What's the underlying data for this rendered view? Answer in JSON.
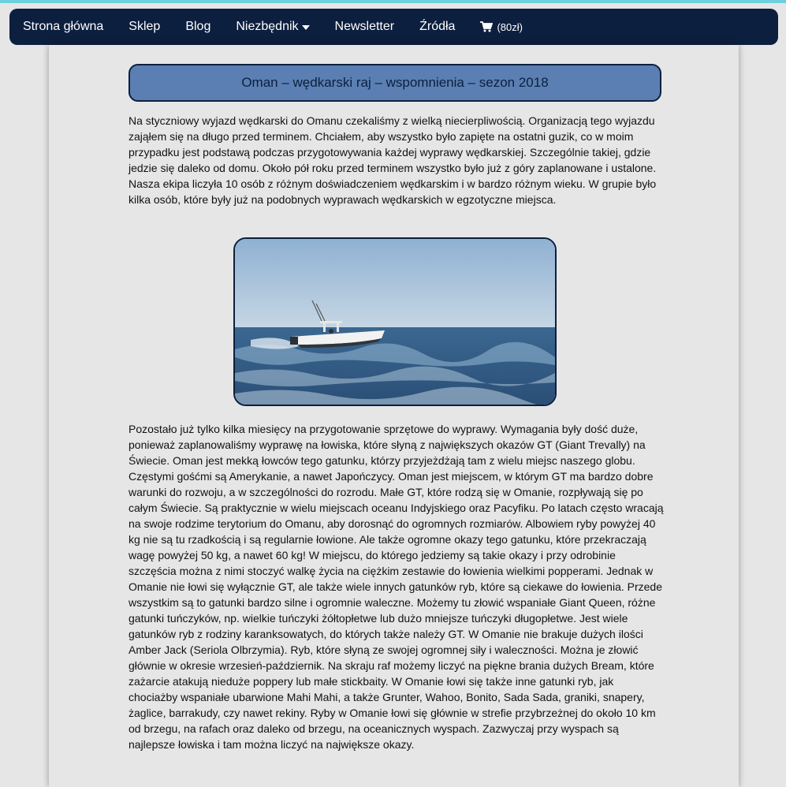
{
  "nav": {
    "items": [
      {
        "label": "Strona główna"
      },
      {
        "label": "Sklep"
      },
      {
        "label": "Blog"
      },
      {
        "label": "Niezbędnik"
      },
      {
        "label": "Newsletter"
      },
      {
        "label": "Źródła"
      }
    ],
    "cart_label": "(80zł)",
    "dropdown_icon": "caret-down-icon",
    "cart_icon": "shopping-cart-icon"
  },
  "article": {
    "title": "Oman – wędkarski raj – wspomnienia – sezon 2018",
    "paragraph1": "Na styczniowy wyjazd wędkarski do Omanu czekaliśmy z wielką niecierpliwością. Organizacją tego wyjazdu zająłem się na długo przed terminem. Chciałem, aby wszystko było zapięte na ostatni guzik, co w moim przypadku jest podstawą podczas przygotowywania każdej wyprawy wędkarskiej. Szczególnie takiej, gdzie jedzie się daleko od domu. Około pół roku przed terminem wszystko było już z góry zaplanowane i ustalone. Nasza ekipa liczyła 10 osób z różnym doświadczeniem wędkarskim i w bardzo różnym wieku. W grupie było kilka osób, które były już na podobnych wyprawach wędkarskich w egzotyczne miejsca.",
    "paragraph2": "Pozostało już tylko kilka miesięcy na przygotowanie sprzętowe do wyprawy. Wymagania były dość duże, ponieważ zaplanowaliśmy wyprawę na łowiska, które słyną z największych okazów GT (Giant Trevally) na Świecie. Oman jest mekką łowców tego gatunku, którzy przyjeżdżają tam z wielu miejsc naszego globu. Częstymi gośćmi są Amerykanie, a nawet Japończycy. Oman jest miejscem, w którym GT ma bardzo dobre warunki do rozwoju, a w szczególności do rozrodu. Małe GT, które rodzą się w Omanie, rozpływają się po całym Świecie. Są praktycznie w wielu miejscach oceanu Indyjskiego oraz Pacyfiku. Po latach często wracają na swoje rodzime terytorium do Omanu, aby dorosnąć do ogromnych rozmiarów. Albowiem ryby powyżej 40 kg nie są tu rzadkością i są regularnie łowione. Ale także ogromne okazy tego gatunku, które przekraczają wagę powyżej 50 kg, a nawet 60 kg! W miejscu, do którego jedziemy są takie okazy i przy odrobinie szczęścia można z nimi stoczyć walkę życia na ciężkim zestawie do łowienia wielkimi popperami. Jednak w Omanie nie łowi się wyłącznie GT, ale także wiele innych gatunków ryb, które są ciekawe do łowienia. Przede wszystkim są to gatunki bardzo silne i ogromnie waleczne. Możemy tu złowić wspaniałe Giant Queen, różne gatunki tuńczyków, np. wielkie tuńczyki żółtopłetwe lub dużo mniejsze tuńczyki długopłetwe. Jest wiele gatunków ryb z rodziny karanksowatych, do których także należy GT. W Omanie nie brakuje dużych ilości Amber Jack (Seriola Olbrzymia). Ryb, które słyną ze swojej ogromnej siły i waleczności. Można je złowić głównie w okresie wrzesień-październik. Na skraju raf możemy liczyć na piękne brania dużych Bream, które zażarcie atakują nieduże poppery lub małe stickbaity. W Omanie łowi się także inne gatunki ryb, jak chociażby wspaniałe ubarwione Mahi Mahi, a także Grunter, Wahoo, Bonito, Sada Sada, graniki, snapery, żaglice, barrakudy, czy nawet rekiny. Ryby w Omanie łowi się głównie w strefie przybrzeżnej do około 10 km od brzegu, na rafach oraz daleko od brzegu, na oceanicznych wyspach. Zazwyczaj przy wyspach są najlepsze łowiska i tam można liczyć na największe okazy.",
    "photo_icon": "fishing-boat-photo"
  }
}
